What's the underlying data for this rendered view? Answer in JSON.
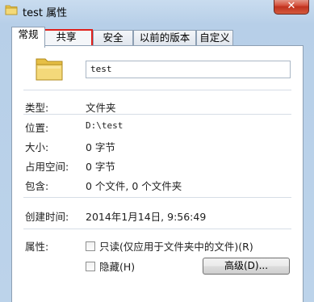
{
  "window": {
    "title": "test 属性",
    "close_glyph": "✕"
  },
  "tabs": [
    {
      "label": "常规",
      "active": true
    },
    {
      "label": "共享",
      "active": false,
      "highlighted": true
    },
    {
      "label": "安全",
      "active": false
    },
    {
      "label": "以前的版本",
      "active": false
    },
    {
      "label": "自定义",
      "active": false
    }
  ],
  "general": {
    "name_value": "test",
    "type_label": "类型:",
    "type_value": "文件夹",
    "location_label": "位置:",
    "location_value": "D:\\test",
    "size_label": "大小:",
    "size_value": "0 字节",
    "size_on_disk_label": "占用空间:",
    "size_on_disk_value": "0 字节",
    "contains_label": "包含:",
    "contains_value": "0 个文件, 0 个文件夹",
    "created_label": "创建时间:",
    "created_value": "2014年1月14日, 9:56:49",
    "attributes_label": "属性:",
    "readonly_label": "只读(仅应用于文件夹中的文件)(R)",
    "hidden_label": "隐藏(H)",
    "advanced_button": "高级(D)..."
  },
  "colors": {
    "highlight_border": "#e0201b",
    "close_button": "#c0321e"
  },
  "icons": {
    "title_icon": "folder-icon",
    "big_icon": "folder-icon",
    "close": "close-icon"
  }
}
